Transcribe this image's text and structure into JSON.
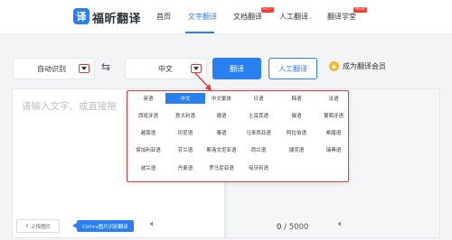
{
  "header": {
    "logo_char": "译",
    "logo_text": "福昕翻译",
    "nav": [
      {
        "label": "首页",
        "active": false
      },
      {
        "label": "文字翻译",
        "active": true
      },
      {
        "label": "文档翻译",
        "active": false,
        "badge": "HOT"
      },
      {
        "label": "人工翻译",
        "active": false,
        "dropdown": "⌄"
      },
      {
        "label": "翻译学堂",
        "active": false,
        "badge": "NEW"
      }
    ]
  },
  "toolbar": {
    "source_lang": "自动识别",
    "swap_symbol": "⇆",
    "target_lang": "中文",
    "translate_label": "翻译",
    "human_translate_label": "人工翻译",
    "member_label": "成为翻译会员"
  },
  "editor": {
    "placeholder": "请输入文字、或直接拖",
    "upload_label": "上传图片",
    "ocr_tag": "Ctrl+v图片识别翻译",
    "char_count": "0",
    "char_max": "/ 5000"
  },
  "dropdown": {
    "languages": [
      [
        "英语",
        "中文",
        "中文繁体",
        "日语",
        "韩语",
        "法语"
      ],
      [
        "西班牙语",
        "意大利语",
        "德语",
        "土耳其语",
        "俄语",
        "葡萄牙语"
      ],
      [
        "越南语",
        "印尼语",
        "泰语",
        "马来西亚语",
        "阿拉伯语",
        "希腊语"
      ],
      [
        "保加利亚语",
        "芬兰语",
        "斯洛文尼亚语",
        "荷兰语",
        "捷克语",
        "瑞典语"
      ],
      [
        "波兰语",
        "丹麦语",
        "罗马尼亚语",
        "匈牙利语"
      ]
    ],
    "selected": "中文"
  },
  "colors": {
    "accent": "#2a7ff0",
    "highlight_border": "#e53935",
    "badge": "#ff3b30",
    "member_icon": "#f5b82e"
  }
}
